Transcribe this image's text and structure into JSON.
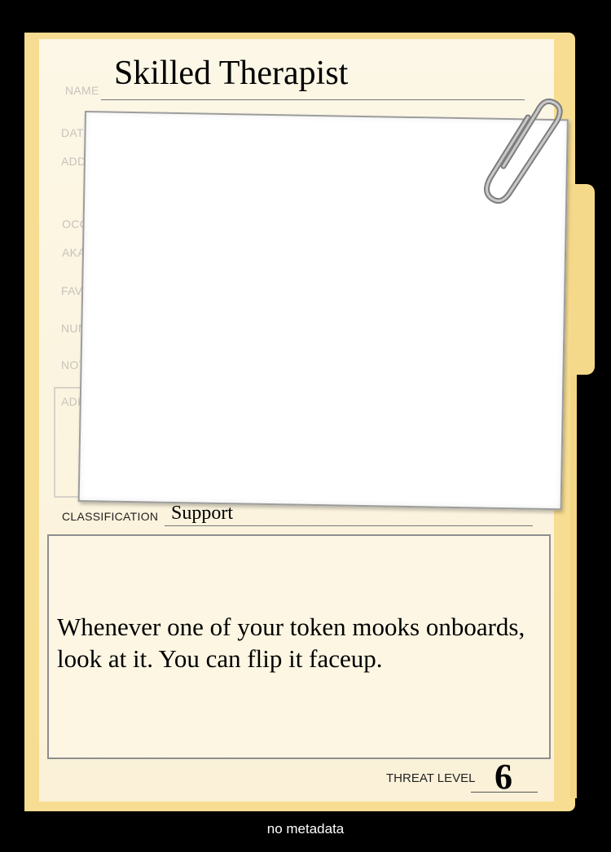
{
  "card": {
    "name": "Skilled Therapist",
    "classification": "Support",
    "ability_text": "Whenever one of your token mooks onboards, look at it. You can flip it faceup.",
    "threat_level": "6"
  },
  "labels": {
    "name": "NAME",
    "date": "DATE",
    "address": "ADDR",
    "occupation": "OCC",
    "aka": "AKA",
    "favorite": "FAVO",
    "number": "NUM",
    "notes": "NOT",
    "additional": "ADI",
    "classification": "CLASSIFICATION",
    "threat_level": "THREAT LEVEL"
  },
  "footer": {
    "text": "no metadata"
  },
  "colors": {
    "background": "#000000",
    "folder": "#f7dd92",
    "paper": "#fcf7e6",
    "faded_label": "#c7c3bc",
    "ink": "#000000"
  },
  "icons": {
    "clip": "paperclip-icon"
  }
}
